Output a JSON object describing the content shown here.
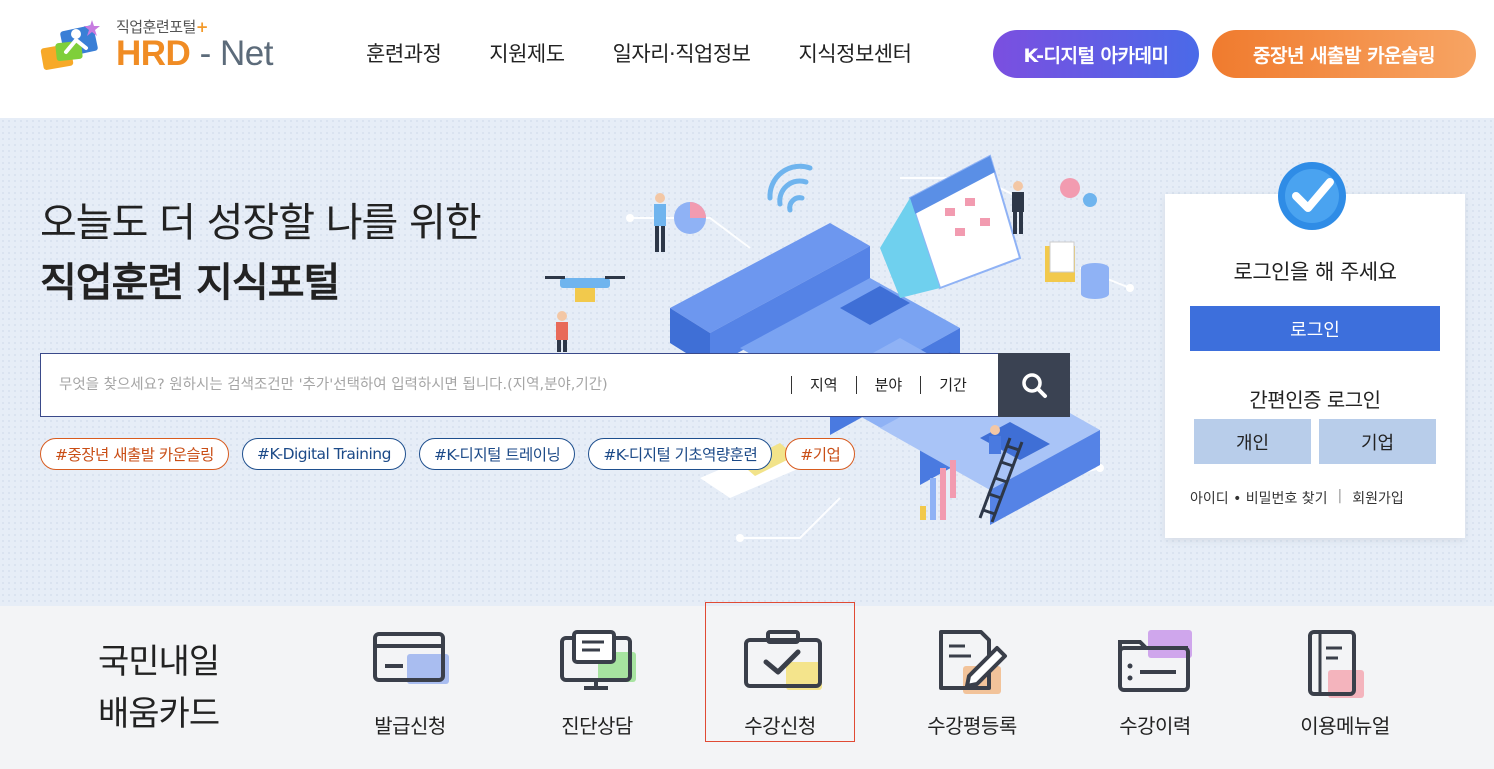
{
  "logo": {
    "subtitle": "직업훈련포털",
    "subtitle_plus": "+",
    "hrd": "HRD",
    "dash": "-",
    "net": "Net"
  },
  "nav": {
    "items": [
      "훈련과정",
      "지원제도",
      "일자리·직업정보",
      "지식정보센터"
    ],
    "kdigital_button": "K-디지털 아카데미",
    "counseling_button": "중장년 새출발 카운슬링"
  },
  "hero": {
    "title_line1": "오늘도 더 성장할 나를 위한",
    "title_line2": "직업훈련 지식포털"
  },
  "search": {
    "placeholder": "무엇을 찾으세요? 원하시는 검색조건만 '추가'선택하여 입력하시면 됩니다.(지역,분야,기간)",
    "filters": [
      "지역",
      "분야",
      "기간"
    ]
  },
  "tags": [
    "#중장년 새출발 카운슬링",
    "#K-Digital Training",
    "#K-디지털 트레이닝",
    "#K-디지털 기초역량훈련",
    "#기업"
  ],
  "login": {
    "prompt": "로그인을 해 주세요",
    "login_button": "로그인",
    "easy_title": "간편인증 로그인",
    "personal_button": "개인",
    "corporate_button": "기업",
    "find_link": "아이디 • 비밀번호 찾기",
    "signup_link": "회원가입"
  },
  "card": {
    "title_line1": "국민내일",
    "title_line2": "배움카드",
    "menu": [
      "발급신청",
      "진단상담",
      "수강신청",
      "수강평등록",
      "수강이력",
      "이용메뉴얼"
    ]
  },
  "colors": {
    "accent_blue": "#3d6fdc",
    "orange": "#f08c24",
    "selected_border": "#e04a34"
  }
}
